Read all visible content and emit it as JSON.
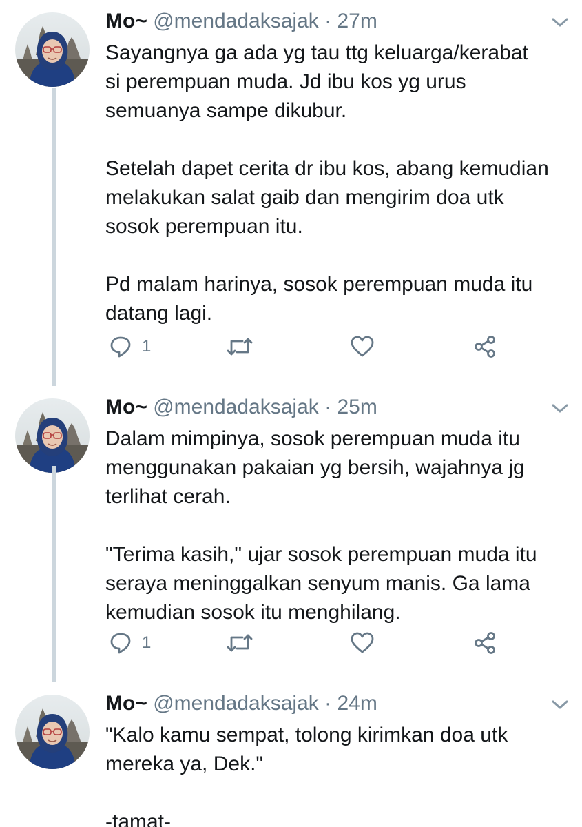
{
  "colors": {
    "text": "#14171a",
    "secondary": "#657786",
    "thread_line": "#ccd6dd",
    "background": "#ffffff"
  },
  "tweets": [
    {
      "author_name": "Mo~",
      "handle": "@mendadaksajak",
      "separator": "·",
      "time": "27m",
      "paragraphs": [
        [
          "Sayangnya ga ada yg tau ttg keluarga/kerabat",
          "si perempuan muda. Jd ibu kos yg urus",
          "semuanya sampe dikubur."
        ],
        [
          "Setelah dapet cerita dr ibu kos, abang kemudian",
          "melakukan salat gaib dan mengirim doa utk",
          "sosok perempuan itu."
        ],
        [
          "Pd malam harinya, sosok perempuan muda itu",
          "datang lagi."
        ]
      ],
      "reply_count": "1",
      "icons": [
        "reply-icon",
        "retweet-icon",
        "like-icon",
        "share-icon"
      ]
    },
    {
      "author_name": "Mo~",
      "handle": "@mendadaksajak",
      "separator": "·",
      "time": "25m",
      "paragraphs": [
        [
          "Dalam mimpinya, sosok perempuan muda itu",
          "menggunakan pakaian yg bersih, wajahnya jg",
          "terlihat cerah."
        ],
        [
          "\"Terima kasih,\" ujar sosok perempuan muda itu",
          "seraya meninggalkan senyum manis. Ga lama",
          "kemudian sosok itu menghilang."
        ]
      ],
      "reply_count": "1",
      "icons": [
        "reply-icon",
        "retweet-icon",
        "like-icon",
        "share-icon"
      ]
    },
    {
      "author_name": "Mo~",
      "handle": "@mendadaksajak",
      "separator": "·",
      "time": "24m",
      "paragraphs": [
        [
          "\"Kalo kamu sempat, tolong kirimkan doa utk",
          "mereka ya, Dek.\""
        ],
        [
          "-tamat-"
        ]
      ]
    }
  ]
}
